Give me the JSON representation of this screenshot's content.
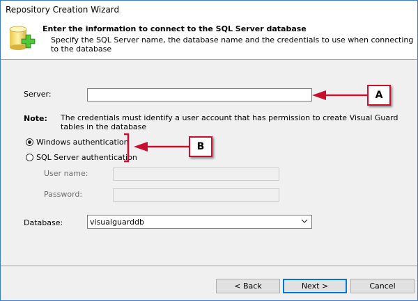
{
  "window": {
    "title": "Repository Creation Wizard"
  },
  "header": {
    "title": "Enter the information to connect to the SQL Server database",
    "subtitle": "Specify the SQL Server name, the database name and the credentials to use when connecting to the database",
    "icon": "database-add-icon"
  },
  "form": {
    "server_label": "Server:",
    "server_value": "",
    "note_label": "Note:",
    "note_text_line1": "The credentials must identify a user account  that has permission to create Visual Guard",
    "note_text_line2": "tables  in the database",
    "auth_options": [
      {
        "label": "Windows authentication",
        "selected": true
      },
      {
        "label": "SQL Server authentication",
        "selected": false
      }
    ],
    "username_label": "User name:",
    "username_value": "",
    "password_label": "Password:",
    "password_value": "",
    "database_label": "Database:",
    "database_value": "visualguarddb"
  },
  "buttons": {
    "back": "< Back",
    "next": "Next >",
    "cancel": "Cancel"
  },
  "annotations": {
    "callout_a": "A",
    "callout_b": "B",
    "color": "#c8102e"
  }
}
